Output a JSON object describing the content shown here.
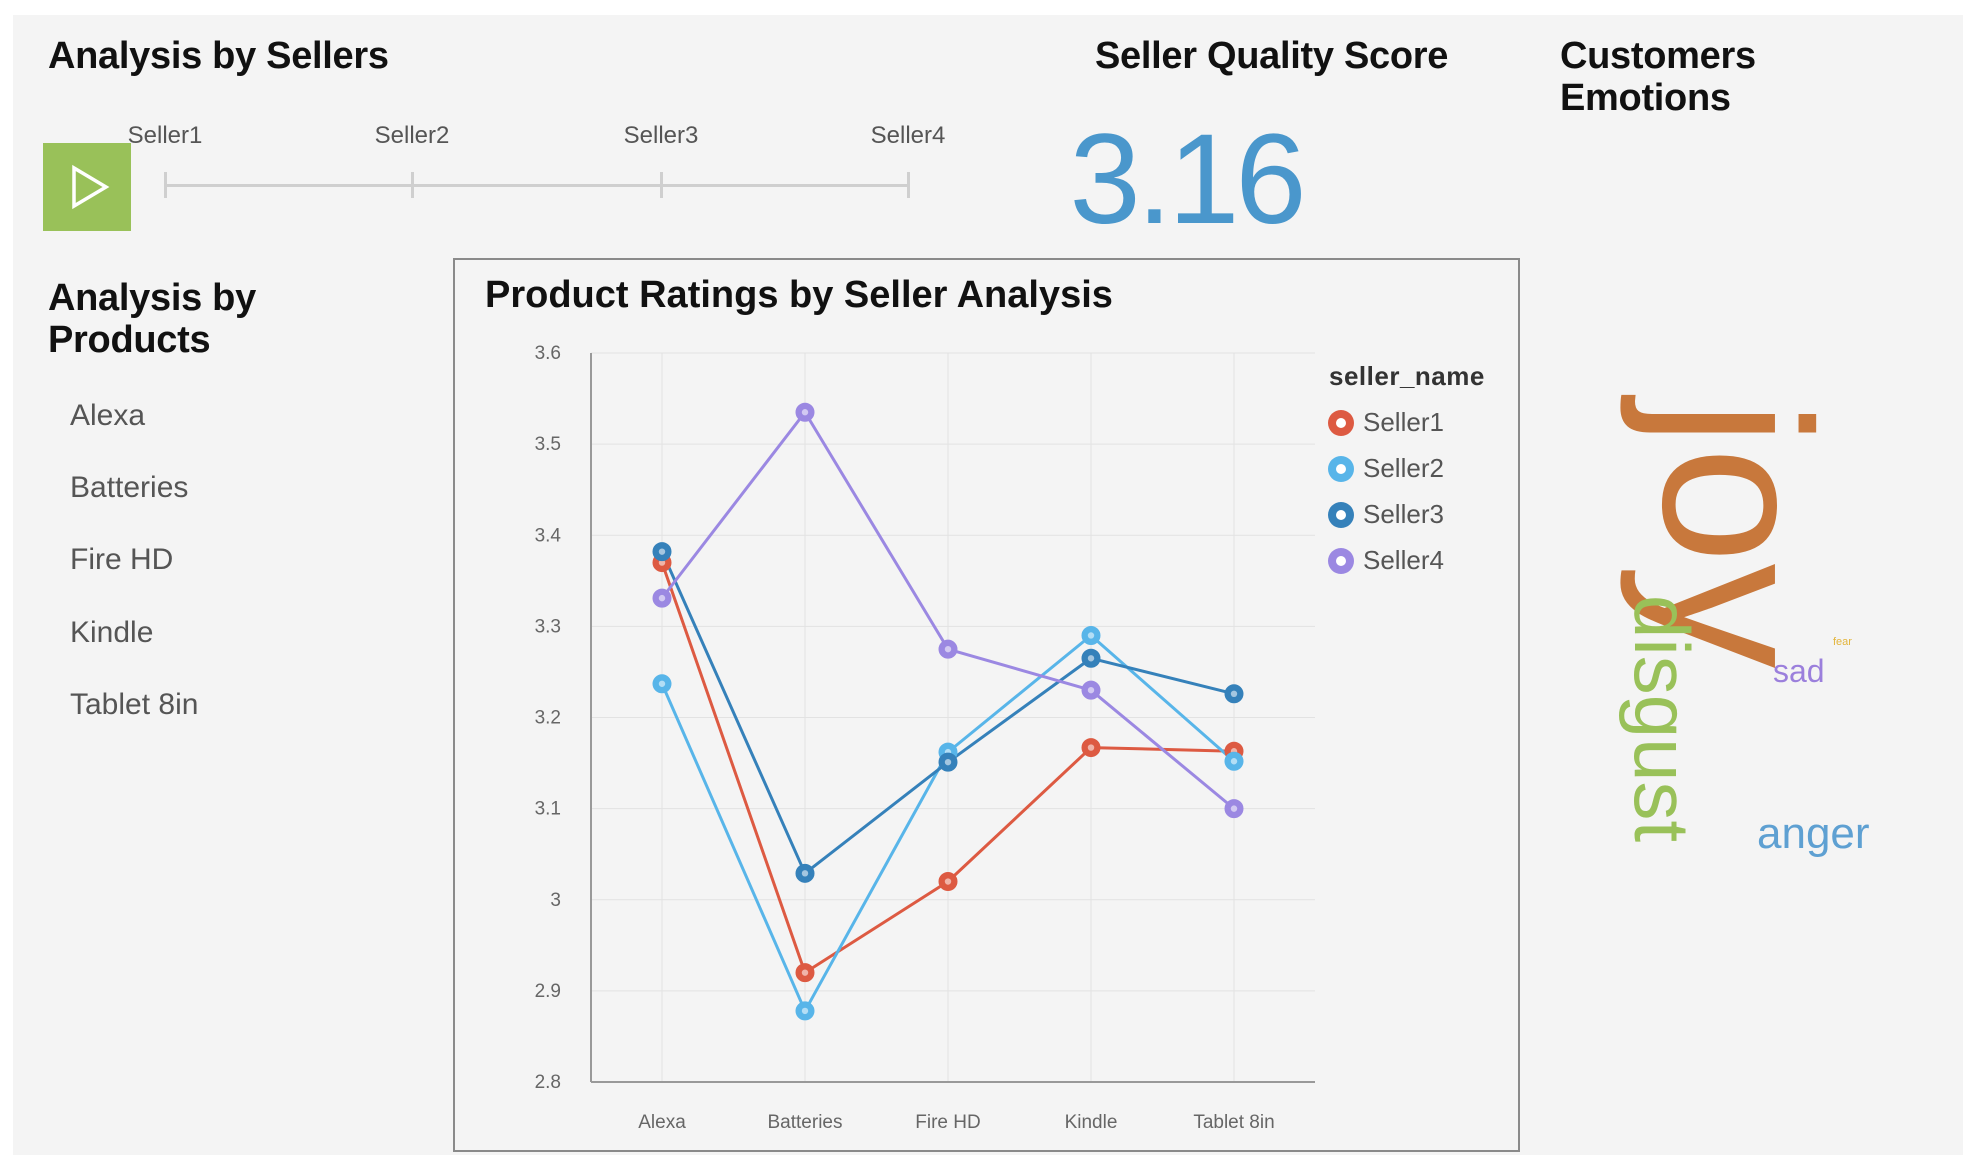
{
  "sellers": {
    "title": "Analysis by Sellers",
    "slider_labels": [
      "Seller1",
      "Seller2",
      "Seller3",
      "Seller4"
    ],
    "play_icon": "play-icon",
    "play_color": "#99c159"
  },
  "quality": {
    "title": "Seller Quality Score",
    "value": "3.16",
    "color": "#4a97cc"
  },
  "emotions": {
    "title_line1": "Customers",
    "title_line2": "Emotions",
    "words": [
      {
        "text": "joy",
        "color": "#c8783c"
      },
      {
        "text": "disgust",
        "color": "#99c159"
      },
      {
        "text": "sad",
        "color": "#9b7fdc"
      },
      {
        "text": "anger",
        "color": "#5ea0d2"
      },
      {
        "text": "fear",
        "color": "#e3b53c"
      }
    ]
  },
  "products": {
    "title_line1": "Analysis by",
    "title_line2": "Products",
    "items": [
      "Alexa",
      "Batteries",
      "Fire HD",
      "Kindle",
      "Tablet 8in"
    ]
  },
  "chart": {
    "title": "Product Ratings by Seller Analysis",
    "legend_title": "seller_name"
  },
  "chart_data": {
    "type": "line",
    "title": "Product Ratings by Seller Analysis",
    "categories": [
      "Alexa",
      "Batteries",
      "Fire HD",
      "Kindle",
      "Tablet 8in"
    ],
    "ylim": [
      2.8,
      3.6
    ],
    "yticks": [
      "2.8",
      "2.9",
      "3",
      "3.1",
      "3.2",
      "3.3",
      "3.4",
      "3.5",
      "3.6"
    ],
    "legend_title": "seller_name",
    "legend_position": "right",
    "grid": true,
    "series": [
      {
        "name": "Seller1",
        "color": "#dd5a42",
        "values": [
          3.37,
          2.92,
          3.02,
          3.167,
          3.163
        ]
      },
      {
        "name": "Seller2",
        "color": "#58b5e9",
        "values": [
          3.237,
          2.878,
          3.162,
          3.29,
          3.152
        ]
      },
      {
        "name": "Seller3",
        "color": "#3581ba",
        "values": [
          3.382,
          3.029,
          3.151,
          3.265,
          3.226
        ]
      },
      {
        "name": "Seller4",
        "color": "#9b88e2",
        "values": [
          3.331,
          3.535,
          3.275,
          3.23,
          3.1
        ]
      }
    ]
  }
}
